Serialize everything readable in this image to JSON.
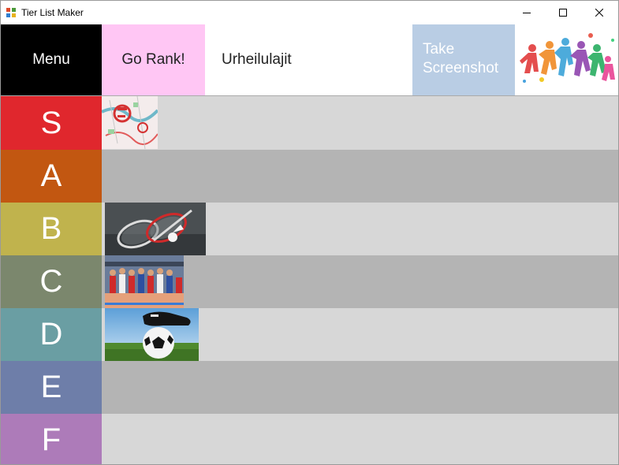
{
  "window": {
    "title": "Tier List Maker",
    "app_icon": "tier-list-app-icon",
    "controls": [
      "minimize-icon",
      "maximize-icon",
      "close-icon"
    ]
  },
  "header": {
    "menu_label": "Menu",
    "go_rank_label": "Go Rank!",
    "list_title": "Urheilulajit",
    "screenshot_line1": "Take",
    "screenshot_line2": "Screenshot",
    "list_image_icon": "sports-silhouettes-image",
    "colors": {
      "menu": "#000000",
      "go_rank": "#ffc6f4",
      "screenshot": "#b9cde4"
    }
  },
  "tiers": [
    {
      "label": "S",
      "color": "#e0272d",
      "row_color": "#d7d7d7",
      "items": [
        "orienteering-map-image"
      ]
    },
    {
      "label": "A",
      "color": "#c25711",
      "row_color": "#b4b4b4",
      "items": []
    },
    {
      "label": "B",
      "color": "#c0b34d",
      "row_color": "#d7d7d7",
      "items": [
        "badminton-racket-image"
      ]
    },
    {
      "label": "C",
      "color": "#7b876d",
      "row_color": "#b4b4b4",
      "items": [
        "volleyball-team-image"
      ]
    },
    {
      "label": "D",
      "color": "#6a9ea3",
      "row_color": "#d7d7d7",
      "items": [
        "soccer-ball-image"
      ]
    },
    {
      "label": "E",
      "color": "#6e7ea9",
      "row_color": "#b4b4b4",
      "items": []
    },
    {
      "label": "F",
      "color": "#ad7bb9",
      "row_color": "#d7d7d7",
      "items": []
    }
  ]
}
